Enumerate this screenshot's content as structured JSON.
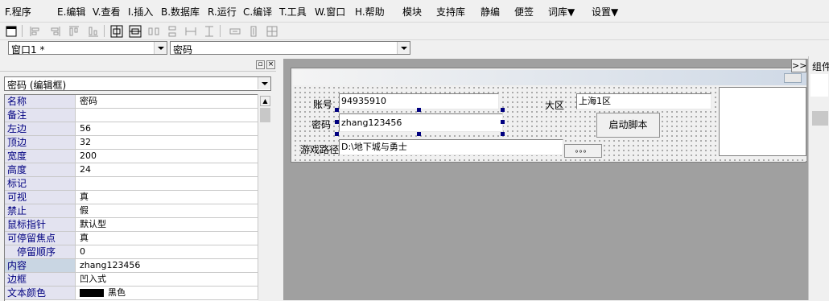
{
  "menu": [
    "F.程序",
    "E.编辑",
    "V.查看",
    "I.插入",
    "B.数据库",
    "R.运行",
    "C.编译",
    "T.工具",
    "W.窗口",
    "H.帮助",
    "模块",
    "支持库",
    "静编",
    "便签",
    "词库▼",
    "设置▼"
  ],
  "toolbar": {
    "icons": [
      "window-icon",
      "align-left-icon",
      "align-right-icon",
      "align-top-icon",
      "align-bottom-icon",
      "center-horizontal-icon",
      "center-vertical-icon",
      "space-horizontal-icon",
      "space-vertical-icon",
      "same-width-icon",
      "same-height-icon",
      "same-size-icon",
      "grid-icon",
      "lock-icon"
    ]
  },
  "selectors": {
    "window": "窗口1 *",
    "component": "密码"
  },
  "properties": {
    "selector": "密码 (编辑框)",
    "rows": [
      {
        "name": "名称",
        "value": "密码"
      },
      {
        "name": "备注",
        "value": ""
      },
      {
        "name": "左边",
        "value": "56"
      },
      {
        "name": "顶边",
        "value": "32"
      },
      {
        "name": "宽度",
        "value": "200"
      },
      {
        "name": "高度",
        "value": "24"
      },
      {
        "name": "标记",
        "value": ""
      },
      {
        "name": "可视",
        "value": "真"
      },
      {
        "name": "禁止",
        "value": "假"
      },
      {
        "name": "鼠标指针",
        "value": "默认型"
      },
      {
        "name": "可停留焦点",
        "value": "真"
      },
      {
        "name": "停留顺序",
        "value": "0"
      },
      {
        "name": "内容",
        "value": "zhang123456"
      },
      {
        "name": "边框",
        "value": "凹入式"
      },
      {
        "name": "文本颜色",
        "value": "黑色"
      }
    ],
    "color_swatch": "#000000"
  },
  "design_form": {
    "account_label": "账号",
    "account_value": "94935910",
    "password_label": "密码",
    "password_value": "zhang123456",
    "path_label": "游戏路径",
    "path_value": "D:\\地下城与勇士",
    "browse_button": "。。。",
    "region_label": "大区",
    "region_value": "上海1区",
    "start_button": "启动脚本"
  },
  "side_panel": {
    "expand": ">>",
    "title": "组件"
  },
  "colors": {
    "selection_handle": "#000080",
    "label_blue": "#000080",
    "design_bg": "#a0a0a0"
  }
}
